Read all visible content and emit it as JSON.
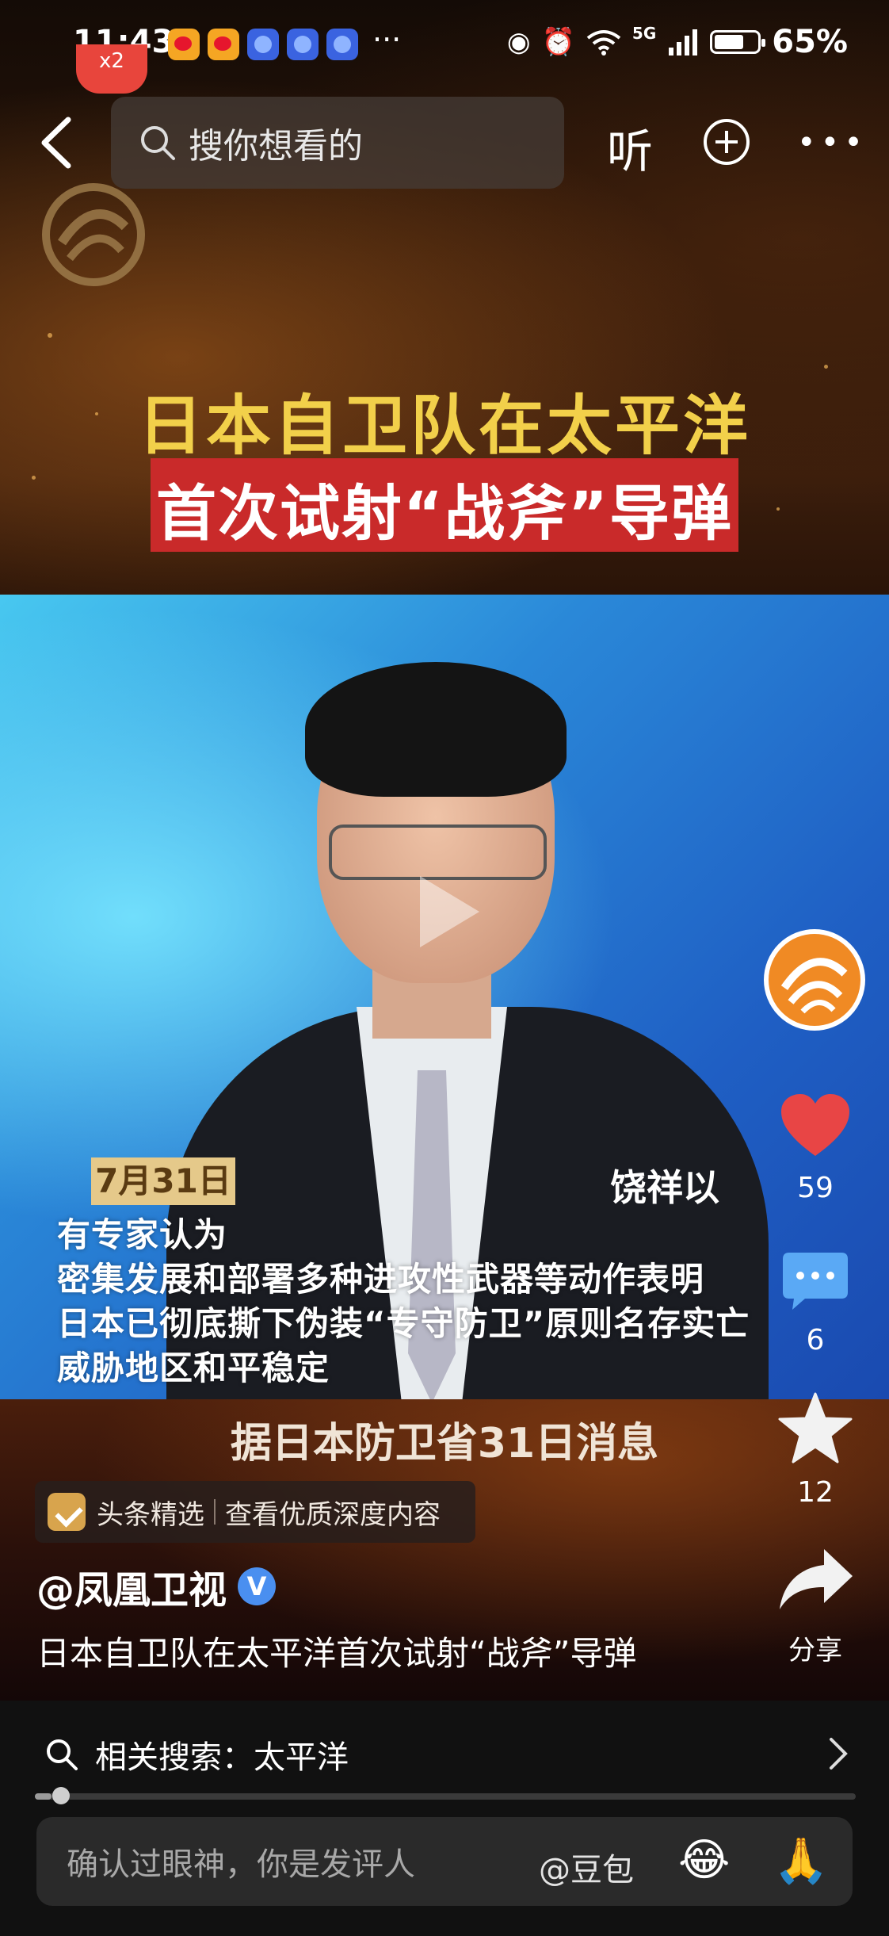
{
  "status_bar": {
    "time": "11:43",
    "more": "···",
    "network": "5G",
    "battery": "65%"
  },
  "badge": "x2",
  "nav": {
    "search_placeholder": "搜你想看的",
    "listen_label": "听"
  },
  "video": {
    "headline_line1": "日本自卫队在太平洋",
    "headline_line2": "首次试射“战斧”导弹",
    "date_tag": "7月31日",
    "reporter": "饶祥以",
    "subtitles": [
      "有专家认为",
      "密集发展和部署多种进攻性武器等动作表明",
      "日本已彻底撕下伪装“专守防卫”原则名存实亡",
      "威胁地区和平稳定"
    ],
    "bottom_caption": "据日本防卫省31日消息"
  },
  "actions": {
    "like_count": "59",
    "comment_count": "6",
    "favorite_count": "12",
    "share_label": "分享"
  },
  "promo": {
    "source": "头条精选",
    "link": "查看优质深度内容"
  },
  "post": {
    "author": "@凤凰卫视",
    "verified_mark": "V",
    "title": "日本自卫队在太平洋首次试射“战斧”导弹"
  },
  "related": {
    "text": "相关搜索：太平洋",
    "progress": 0.02
  },
  "comment_bar": {
    "placeholder": "确认过眼神，你是发评人",
    "mention": "@豆包",
    "emoji1": "😂",
    "emoji2": "🙏"
  },
  "colors": {
    "headline_yellow": "#f2d04a",
    "headline_red": "#c92a2a",
    "like_red": "#e84545",
    "comment_blue": "#5aa9f5"
  }
}
